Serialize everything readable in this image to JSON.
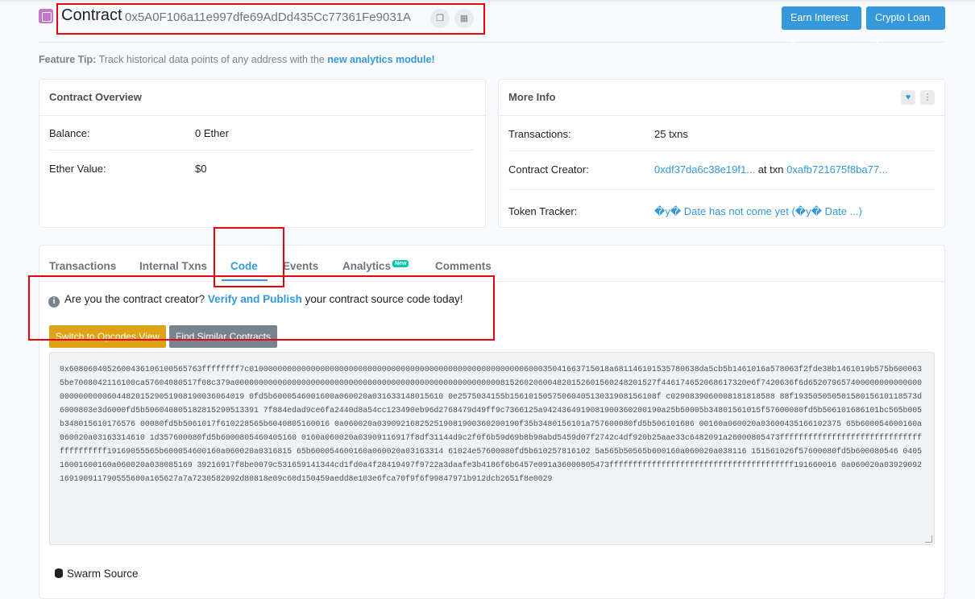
{
  "header": {
    "title": "Contract",
    "address": "0x5A0F106a11e997dfe69AdDd435Cc77361Fe9031A",
    "buttons": {
      "earn": "Earn Interest",
      "loan": "Crypto Loan"
    }
  },
  "tip": {
    "label": "Feature Tip:",
    "text": "Track historical data points of any address with the",
    "link": "new analytics module!"
  },
  "overview": {
    "title": "Contract Overview",
    "balance_label": "Balance:",
    "balance_value": "0 Ether",
    "ether_value_label": "Ether Value:",
    "ether_value": "$0"
  },
  "more_info": {
    "title": "More Info",
    "transactions_label": "Transactions:",
    "transactions_value": "25 txns",
    "creator_label": "Contract Creator:",
    "creator_address": "0xdf37da6c38e19f1...",
    "creator_at": "at txn",
    "creator_txn": "0xafb721675f8ba77...",
    "token_label": "Token Tracker:",
    "token_value": "�y� Date has not come yet (�y� Date ...)"
  },
  "tabs": [
    {
      "label": "Transactions"
    },
    {
      "label": "Internal Txns"
    },
    {
      "label": "Code"
    },
    {
      "label": "Events"
    },
    {
      "label": "Analytics",
      "badge": "New"
    },
    {
      "label": "Comments"
    }
  ],
  "code_section": {
    "info_pre": "Are you the contract creator?",
    "info_link": "Verify and Publish",
    "info_post": "your contract source code today!",
    "switch_opcodes": "Switch to Opcodes View",
    "find_similar": "Find Similar Contracts",
    "bytecode": "0x6080604052600436106100565763ffffffff7c0100000000000000000000000000000000000000000000000000000000600035041663715018a681146101535780638da5cb5b1461016a578063f2fde38b1461019b575b6000635be7008042116100ca57604080517f08c379a00000000000000000000000000000000000000000000000000000000815260206004820152601560248201527f446174652068617320e6f7420636f6d652079657400000000000000000000000060448201529051908190036064019 0fd5b6000546001600a060020a031633148015610 0e2575034155b1561015057506040513031908156108f c0290839060008181818588 88f19350505050158015610118573d6000803e3d6000fd5b506040805182815290513391 7f884edad9ce6fa2440d8a54cc123490eb96d2768479d49ff9c7366125a9424364919081900360200190a25b50005b34801561015f57600080fd5b506101686101bc565b005b348015610176576 00080fd5b5061017f610228565b6040805160016 0a060020a039092168252519081900360200190f35b3480156101a757600080fd5b506101686 00160a060020a03600435166102375 65b600054600160a060020a03163314610 1d357600080fd5b6000805460405160 0160a060020a03909116917f8df31144d9c2f0f6b59d69b8b98abd5459d07f2742c4df920b25aae33c6482091a26000805473ffffffffffffffffffffffffffffffffffffffff19169055565b600054600160a060020a0316815 65b600054600160a060020a03163314 61024e57600080fd5b610257816102 5a565b50565b600160a060020a038116 151561026f57600080fd5b600080546 040516001600160a060020a038085169 39216917f8be0079c531659141344cd1fd0a4f28419497f9722a3daafe3b4186f6b6457e091a36000805473fffffffffffffffffffffffffffffffffffffff191660016 0a060020a03929092169190911790555600a165627a7a7230582092d80818e09c60d150459aedd8e103e6fca70f9f6f99847971b912dcb2651f8e0029"
  },
  "swarm": {
    "label": "Swarm Source"
  }
}
